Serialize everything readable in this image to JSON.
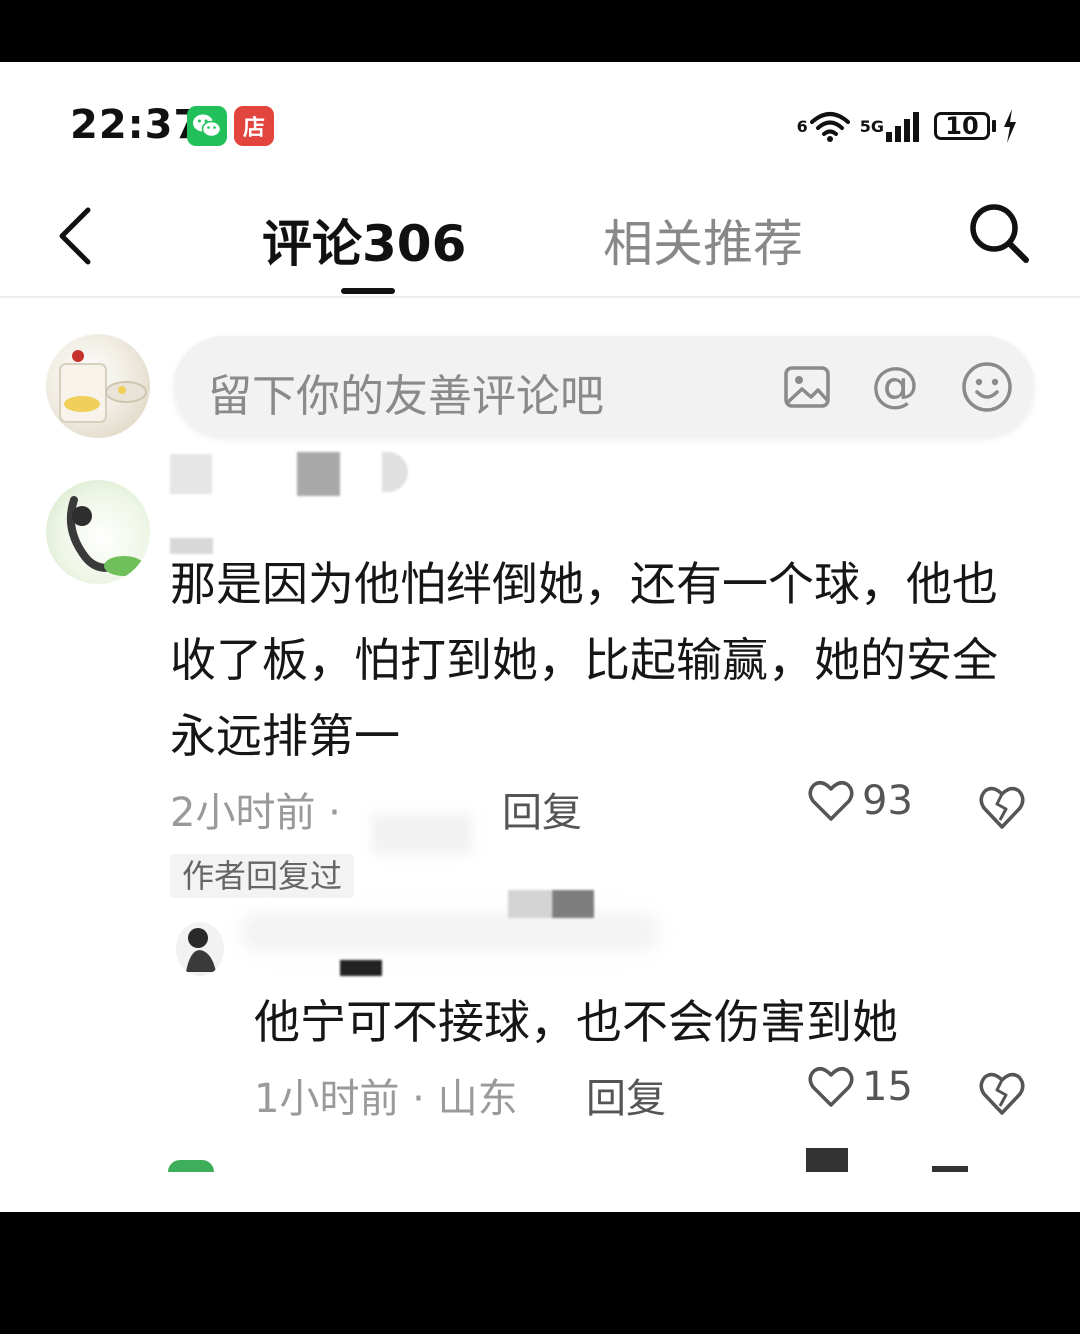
{
  "status_bar": {
    "time": "22:37",
    "app_icons": [
      {
        "name": "wechat-icon",
        "glyph": "",
        "color": "#21c05a"
      },
      {
        "name": "shop-icon",
        "glyph": "店",
        "color": "#e2443e"
      }
    ],
    "wifi_label": "6",
    "network_label": "5G",
    "battery_level": "10"
  },
  "header": {
    "tab_comments": "评论306",
    "tab_related": "相关推荐"
  },
  "comment_input": {
    "placeholder": "留下你的友善评论吧"
  },
  "comments": [
    {
      "text": "那是因为他怕绊倒她，还有一个球，他也收了板，怕打到她，比起输赢，她的安全永远排第一",
      "time": "2小时前",
      "separator": "·",
      "reply_label": "回复",
      "likes": "93",
      "author_badge": "作者回复过"
    },
    {
      "text": "他宁可不接球，也不会伤害到她",
      "time": "1小时前",
      "separator": "·",
      "location": "山东",
      "reply_label": "回复",
      "likes": "15"
    }
  ],
  "colors": {
    "text_primary": "#161616",
    "text_secondary": "#9a9a9a",
    "inactive_tab": "#888888",
    "input_background": "#f2f2f2"
  }
}
